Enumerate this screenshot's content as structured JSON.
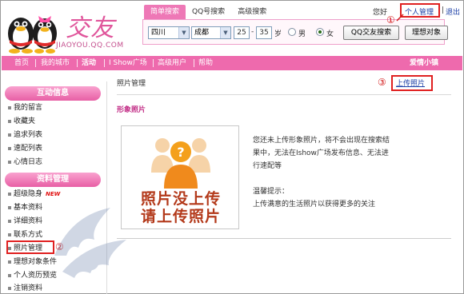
{
  "header": {
    "brand": "交友",
    "domain": "JIAOYOU.QQ.COM",
    "search_tabs": [
      {
        "label": "简单搜索",
        "active": true
      },
      {
        "label": "QQ号搜索",
        "active": false
      },
      {
        "label": "高级搜索",
        "active": false
      }
    ],
    "search": {
      "province": "四川",
      "city": "成都",
      "age_from": "25",
      "age_dash": "-",
      "age_to": "35",
      "age_unit": "岁",
      "gender_male": "男",
      "gender_female": "女",
      "gender_selected": "female",
      "search_button": "QQ交友搜索",
      "ideal_button": "理想对象"
    },
    "greeting": "您好",
    "personal_admin": "个人管理",
    "logout": "退出"
  },
  "annotations": {
    "one": "①",
    "two": "②",
    "three": "③",
    "highlight_color": "#e02020"
  },
  "nav": {
    "items": [
      {
        "label": "首页",
        "bold": false
      },
      {
        "label": "我的城市",
        "bold": false
      },
      {
        "label": "活动",
        "bold": true
      },
      {
        "label": "I Show广场",
        "bold": false
      },
      {
        "label": "高级用户",
        "bold": false
      },
      {
        "label": "帮助",
        "bold": false
      }
    ],
    "right_label": "爱情小镇",
    "color": "#ee6aad"
  },
  "sidebar": {
    "section1_title": "互动信息",
    "section1_items": [
      "我的留言",
      "收藏夹",
      "追求列表",
      "速配列表",
      "心情日志"
    ],
    "section2_title": "资料管理",
    "section2_items": [
      {
        "label": "超级隐身",
        "badge": "NEW"
      },
      {
        "label": "基本资料",
        "badge": ""
      },
      {
        "label": "详细资料",
        "badge": ""
      },
      {
        "label": "联系方式",
        "badge": ""
      },
      {
        "label": "照片管理",
        "badge": ""
      },
      {
        "label": "理想对象条件",
        "badge": ""
      },
      {
        "label": "个人资历预览",
        "badge": ""
      },
      {
        "label": "注销资料",
        "badge": ""
      }
    ]
  },
  "main": {
    "title": "照片管理",
    "upload_link": "上传照片",
    "section_title": "形象照片",
    "placeholder_line1": "照片没上传",
    "placeholder_line2": "请上传照片",
    "info_lines": [
      "您还未上传形象照片，将不会出现在搜索结",
      "果中，无法在Ishow广场发布信息、无法进",
      "行速配等"
    ],
    "tip_title": "温馨提示：",
    "tip_text": "上传满意的生活照片以获得更多的关注"
  }
}
